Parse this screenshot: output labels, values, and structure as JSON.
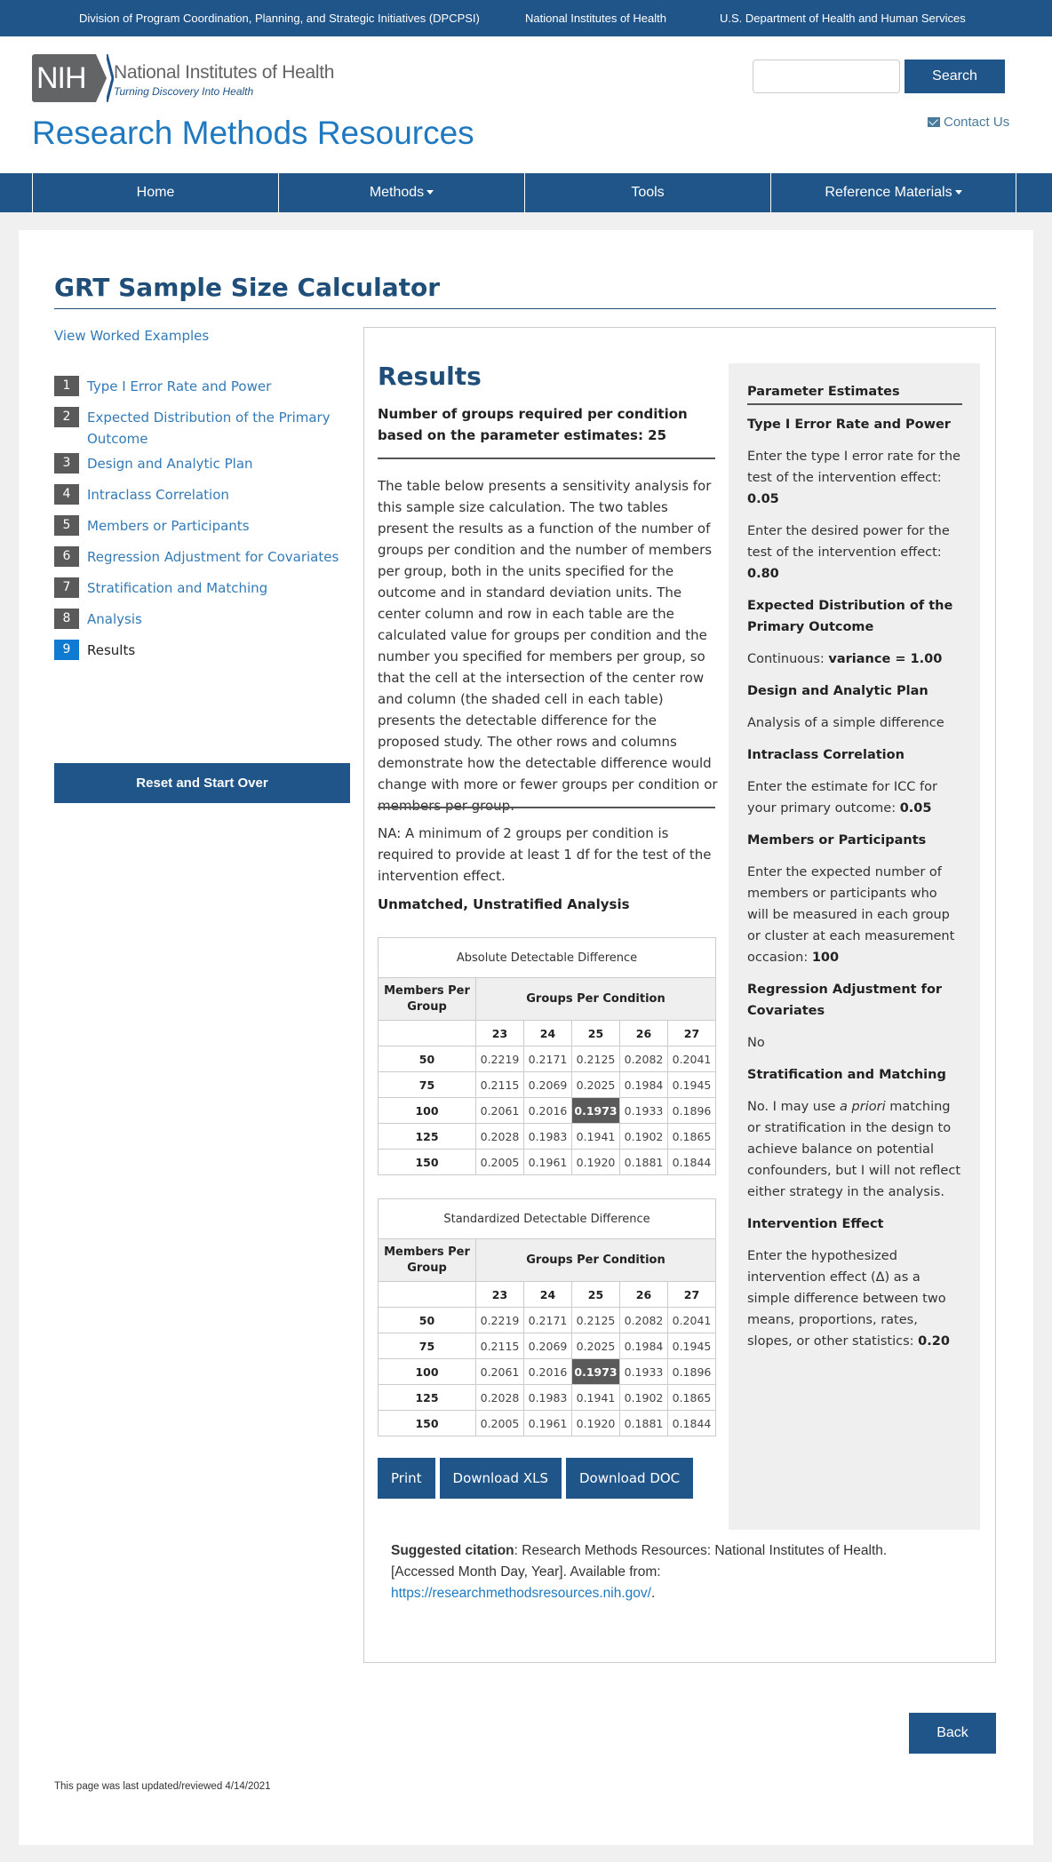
{
  "topbar": {
    "links": [
      "Division of Program Coordination, Planning, and Strategic Initiatives (DPCPSI)",
      "National Institutes of Health",
      "U.S. Department of Health and Human Services"
    ]
  },
  "header": {
    "logo_abbr": "NIH",
    "logo_name": "National Institutes of Health",
    "logo_tagline": "Turning Discovery Into Health",
    "site_title": "Research Methods Resources",
    "search_placeholder": "",
    "search_value": "",
    "search_label": "Search",
    "contact_label": "Contact Us"
  },
  "nav": {
    "items": [
      {
        "label": "Home",
        "dropdown": false
      },
      {
        "label": "Methods",
        "dropdown": true
      },
      {
        "label": "Tools",
        "dropdown": false
      },
      {
        "label": "Reference Materials",
        "dropdown": true
      }
    ]
  },
  "page": {
    "title": "GRT Sample Size Calculator",
    "worked_examples_label": "View Worked Examples",
    "steps": [
      {
        "num": "1",
        "label": "Type I Error Rate and Power"
      },
      {
        "num": "2",
        "label": "Expected Distribution of the Primary Outcome"
      },
      {
        "num": "3",
        "label": "Design and Analytic Plan"
      },
      {
        "num": "4",
        "label": "Intraclass Correlation"
      },
      {
        "num": "5",
        "label": "Members or Participants"
      },
      {
        "num": "6",
        "label": "Regression Adjustment for Covariates"
      },
      {
        "num": "7",
        "label": "Stratification and Matching"
      },
      {
        "num": "8",
        "label": "Analysis"
      },
      {
        "num": "9",
        "label": "Results",
        "active": true
      }
    ],
    "reset_label": "Reset and Start Over",
    "back_label": "Back",
    "last_updated": "This page was last updated/reviewed 4/14/2021"
  },
  "results": {
    "title": "Results",
    "summary": "Number of groups required per condition based on the parameter estimates: 25",
    "description": "The table below presents a sensitivity analysis for this sample size calculation. The two tables present the results as a function of the number of groups per condition and the number of members per group, both in the units specified for the outcome and in standard deviation units. The center column and row in each table are the calculated value for groups per condition and the number you specified for members per group, so that the cell at the intersection of the center row and column (the shaded cell in each table) presents the detectable difference for the proposed study. The other rows and columns demonstrate how the detectable difference would change with more or fewer groups per condition or members per group.",
    "na_note": "NA: A minimum of 2 groups per condition is required to provide at least 1 df for the test of the intervention effect.",
    "analysis_label": "Unmatched, Unstratified Analysis",
    "tables": [
      {
        "caption": "Absolute Detectable Difference",
        "row_header": "Members Per Group",
        "col_header": "Groups Per Condition",
        "columns": [
          "23",
          "24",
          "25",
          "26",
          "27"
        ],
        "rows": [
          {
            "label": "50",
            "values": [
              "0.2219",
              "0.2171",
              "0.2125",
              "0.2082",
              "0.2041"
            ]
          },
          {
            "label": "75",
            "values": [
              "0.2115",
              "0.2069",
              "0.2025",
              "0.1984",
              "0.1945"
            ]
          },
          {
            "label": "100",
            "values": [
              "0.2061",
              "0.2016",
              "0.1973",
              "0.1933",
              "0.1896"
            ]
          },
          {
            "label": "125",
            "values": [
              "0.2028",
              "0.1983",
              "0.1941",
              "0.1902",
              "0.1865"
            ]
          },
          {
            "label": "150",
            "values": [
              "0.2005",
              "0.1961",
              "0.1920",
              "0.1881",
              "0.1844"
            ]
          }
        ],
        "highlight": {
          "row": 2,
          "col": 2
        }
      },
      {
        "caption": "Standardized Detectable Difference",
        "row_header": "Members Per Group",
        "col_header": "Groups Per Condition",
        "columns": [
          "23",
          "24",
          "25",
          "26",
          "27"
        ],
        "rows": [
          {
            "label": "50",
            "values": [
              "0.2219",
              "0.2171",
              "0.2125",
              "0.2082",
              "0.2041"
            ]
          },
          {
            "label": "75",
            "values": [
              "0.2115",
              "0.2069",
              "0.2025",
              "0.1984",
              "0.1945"
            ]
          },
          {
            "label": "100",
            "values": [
              "0.2061",
              "0.2016",
              "0.1973",
              "0.1933",
              "0.1896"
            ]
          },
          {
            "label": "125",
            "values": [
              "0.2028",
              "0.1983",
              "0.1941",
              "0.1902",
              "0.1865"
            ]
          },
          {
            "label": "150",
            "values": [
              "0.2005",
              "0.1961",
              "0.1920",
              "0.1881",
              "0.1844"
            ]
          }
        ],
        "highlight": {
          "row": 2,
          "col": 2
        }
      }
    ],
    "buttons": {
      "print": "Print",
      "xls": "Download XLS",
      "doc": "Download DOC"
    }
  },
  "params": {
    "heading": "Parameter Estimates",
    "sections": [
      {
        "title": "Type I Error Rate and Power",
        "items": [
          {
            "text": "Enter the type I error rate for the test of the intervention effect: ",
            "value": "0.05"
          },
          {
            "text": "Enter the desired power for the test of the intervention effect: ",
            "value": "0.80"
          }
        ]
      },
      {
        "title": "Expected Distribution of the Primary Outcome",
        "items": [
          {
            "text": "Continuous: ",
            "value": "variance = 1.00"
          }
        ]
      },
      {
        "title": "Design and Analytic Plan",
        "items": [
          {
            "text": "Analysis of a simple difference",
            "value": ""
          }
        ]
      },
      {
        "title": "Intraclass Correlation",
        "items": [
          {
            "text": "Enter the estimate for ICC for your primary outcome: ",
            "value": "0.05"
          }
        ]
      },
      {
        "title": "Members or Participants",
        "items": [
          {
            "text": "Enter the expected number of members or participants who will be measured in each group or cluster at each measurement occasion: ",
            "value": "100"
          }
        ]
      },
      {
        "title": "Regression Adjustment for Covariates",
        "items": [
          {
            "text": "No",
            "value": ""
          }
        ]
      },
      {
        "title": "Stratification and Matching",
        "items": [
          {
            "text_before": "No. I may use ",
            "italic": "a priori",
            "text_after": " matching or stratification in the design to achieve balance on potential confounders, but I will not reflect either strategy in the analysis."
          }
        ]
      },
      {
        "title": "Intervention Effect",
        "items": [
          {
            "text": "Enter the hypothesized intervention effect (Δ) as a simple difference between two means, proportions, rates, slopes, or other statistics: ",
            "value": "0.20"
          }
        ]
      }
    ]
  },
  "citation": {
    "label": "Suggested citation",
    "text": ": Research Methods Resources: National Institutes of Health. [Accessed Month Day, Year]. Available from: ",
    "link": "https://researchmethodsresources.nih.gov/",
    "tail": "."
  },
  "colors": {
    "brand_blue": "#20558a",
    "link_blue": "#337ab7",
    "title_blue": "#1f79c0",
    "highlight_cell": "#5a5a5a",
    "active_step": "#0e7ad1"
  }
}
